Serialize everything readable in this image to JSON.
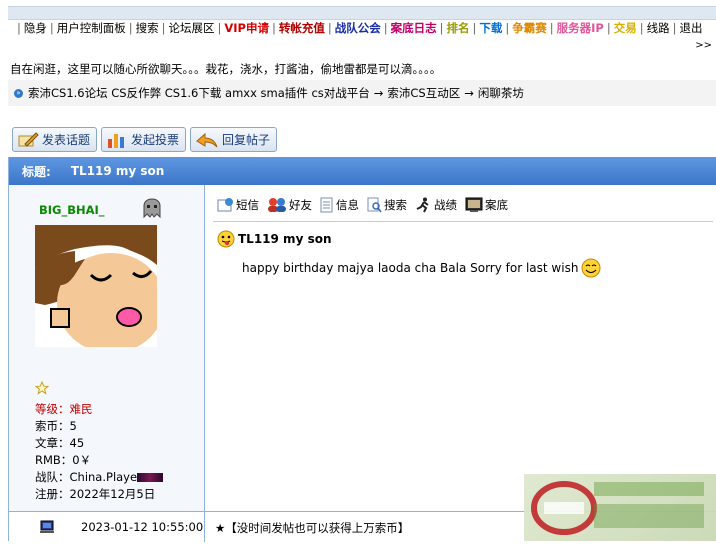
{
  "nav": {
    "items": [
      {
        "label": "隐身",
        "color": "#000000"
      },
      {
        "label": "用户控制面板",
        "color": "#000000"
      },
      {
        "label": "搜索",
        "color": "#000000"
      },
      {
        "label": "论坛展区",
        "color": "#000000"
      },
      {
        "label": "VIP申请",
        "color": "#d40000"
      },
      {
        "label": "转帐充值",
        "color": "#b00000"
      },
      {
        "label": "战队公会",
        "color": "#1a2faa"
      },
      {
        "label": "案底日志",
        "color": "#c0006a"
      },
      {
        "label": "排名",
        "color": "#9a9a00"
      },
      {
        "label": "下载",
        "color": "#006fd6"
      },
      {
        "label": "争霸赛",
        "color": "#e08a00"
      },
      {
        "label": "服务器IP",
        "color": "#e0569a"
      },
      {
        "label": "交易",
        "color": "#d8b000"
      },
      {
        "label": "线路",
        "color": "#000000"
      },
      {
        "label": "退出",
        "color": "#000000"
      }
    ],
    "more": ">>"
  },
  "welcome": "自在闲逛，这里可以随心所欲聊天。。。栽花，浇水，打酱油，偷地雷都是可以滴。。。。",
  "breadcrumb": {
    "first": "索沛CS1.6论坛 CS反作弊 CS1.6下载 amxx sma插件 cs对战平台",
    "arrow": "→",
    "second": "索沛CS互动区",
    "third": "闲聊茶坊"
  },
  "actions": {
    "new_topic": "发表话题",
    "new_poll": "发起投票",
    "reply": "回复帖子"
  },
  "thread": {
    "title_label": "标题:",
    "title": "TL119 my son"
  },
  "user": {
    "name": "BIG_BHAI_",
    "level_label": "等级：难民",
    "coins": "索币：5",
    "posts": "文章：45",
    "rmb": "RMB：0￥",
    "team": "战队：China.Playe",
    "registered": "注册：2022年12月5日"
  },
  "tools": {
    "message": "短信",
    "friend": "好友",
    "info": "信息",
    "search": "搜索",
    "record": "战绩",
    "case": "案底"
  },
  "post": {
    "title": "TL119 my son",
    "body": "happy birthday majya laoda cha Bala Sorry for last wish"
  },
  "footer": {
    "time": "2023-01-12 10:55:00",
    "message": "★【没时间发帖也可以获得上万索币】"
  }
}
